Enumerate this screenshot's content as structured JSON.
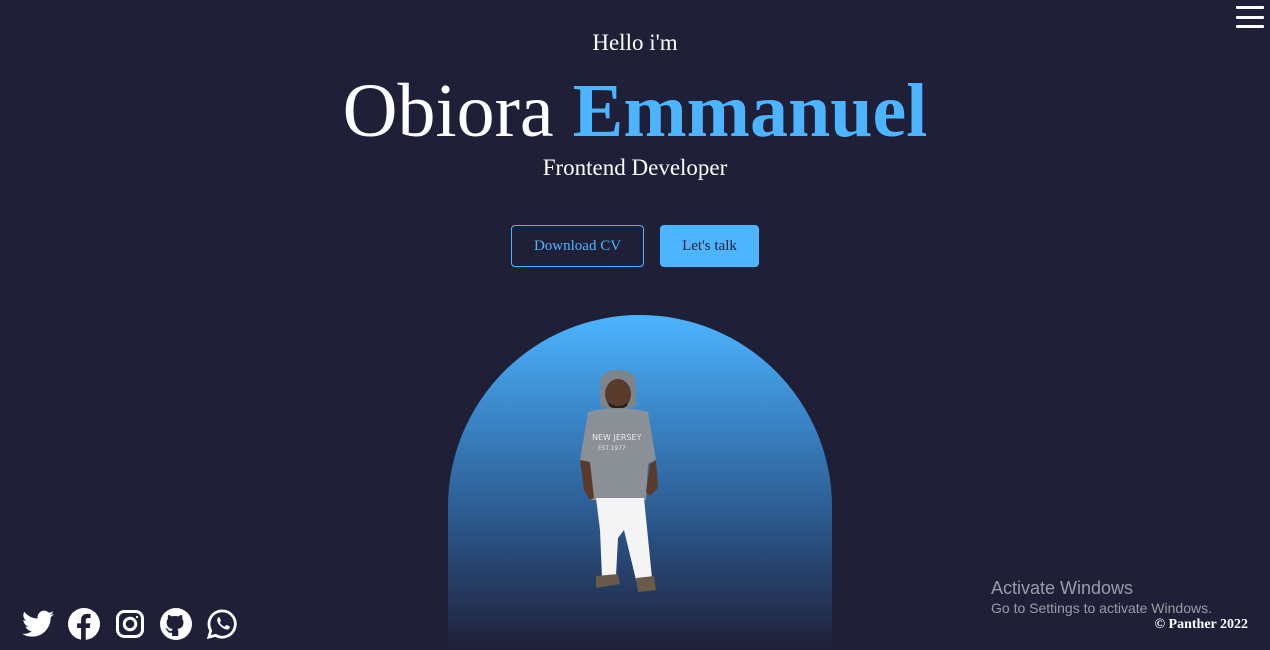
{
  "header": {
    "greeting": "Hello i'm",
    "first_name": "Obiora",
    "last_name": "Emmanuel",
    "role": "Frontend Developer"
  },
  "buttons": {
    "download_cv": "Download CV",
    "lets_talk": "Let's talk"
  },
  "nav": {
    "menu_icon": "hamburger-menu-icon"
  },
  "socials": [
    {
      "name": "twitter-icon"
    },
    {
      "name": "facebook-icon"
    },
    {
      "name": "instagram-icon"
    },
    {
      "name": "github-icon"
    },
    {
      "name": "whatsapp-icon"
    }
  ],
  "windows_watermark": {
    "title": "Activate Windows",
    "subtitle": "Go to Settings to activate Windows."
  },
  "footer": {
    "copyright": "© Panther 2022"
  },
  "colors": {
    "background": "#1f1f38",
    "accent": "#4db5ff",
    "text": "#ffffff"
  }
}
